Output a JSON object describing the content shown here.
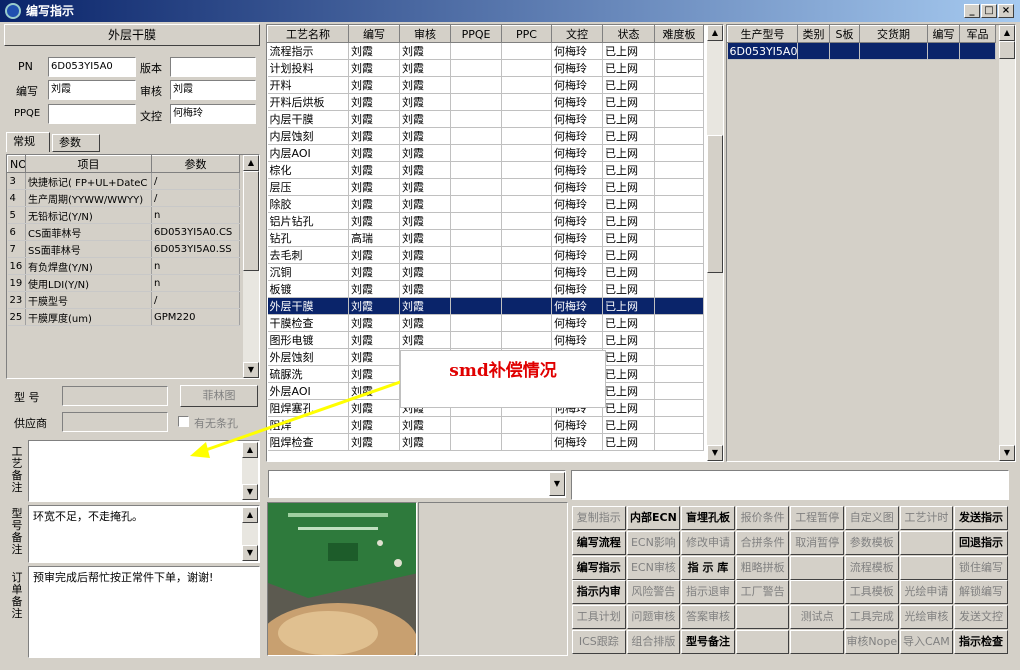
{
  "window": {
    "title": "编写指示"
  },
  "left": {
    "header": "外层干膜",
    "pn_label": "PN",
    "pn": "6D053YI5A0",
    "version_label": "版本",
    "version": "",
    "writer_label": "编写",
    "writer": "刘霞",
    "reviewer_label": "审核",
    "reviewer": "刘霞",
    "ppqe_label": "PPQE",
    "ppqe": "",
    "dc_label": "文控",
    "dc": "何梅玲",
    "tabs": [
      "常规",
      "参数"
    ],
    "param_headers": [
      "NO",
      "项目",
      "参数"
    ],
    "params": [
      {
        "no": "3",
        "item": "快捷标记( FP+UL+DateC",
        "val": "/"
      },
      {
        "no": "4",
        "item": "生产周期(YYWW/WWYY)",
        "val": "/"
      },
      {
        "no": "5",
        "item": "无铅标记(Y/N)",
        "val": "n"
      },
      {
        "no": "6",
        "item": "CS面菲林号",
        "val": "6D053YI5A0.CS"
      },
      {
        "no": "7",
        "item": "SS面菲林号",
        "val": "6D053YI5A0.SS"
      },
      {
        "no": "16",
        "item": "有负焊盘(Y/N)",
        "val": "n"
      },
      {
        "no": "19",
        "item": "使用LDI(Y/N)",
        "val": "n"
      },
      {
        "no": "23",
        "item": "干膜型号",
        "val": "/"
      },
      {
        "no": "25",
        "item": "干膜厚度(um)",
        "val": "GPM220"
      }
    ],
    "model_label": "型 号",
    "model": "",
    "film_button": "菲林图",
    "supplier_label": "供应商",
    "supplier": "",
    "no_slot_label": "有无条孔",
    "process_note_label": "工艺备注",
    "process_note": "",
    "model_note_label": "型号备注",
    "model_note": "环宽不足，不走掩孔。",
    "order_note_label": "订单备注",
    "order_note": "预审完成后帮忙按正常件下单，谢谢!"
  },
  "process": {
    "headers": [
      "工艺名称",
      "编写",
      "审核",
      "PPQE",
      "PPC",
      "文控",
      "状态",
      "难度板"
    ],
    "rows": [
      [
        "流程指示",
        "刘霞",
        "刘霞",
        "",
        "",
        "何梅玲",
        "已上网",
        ""
      ],
      [
        "计划投料",
        "刘霞",
        "刘霞",
        "",
        "",
        "何梅玲",
        "已上网",
        ""
      ],
      [
        "开料",
        "刘霞",
        "刘霞",
        "",
        "",
        "何梅玲",
        "已上网",
        ""
      ],
      [
        "开料后烘板",
        "刘霞",
        "刘霞",
        "",
        "",
        "何梅玲",
        "已上网",
        ""
      ],
      [
        "内层干膜",
        "刘霞",
        "刘霞",
        "",
        "",
        "何梅玲",
        "已上网",
        ""
      ],
      [
        "内层蚀刻",
        "刘霞",
        "刘霞",
        "",
        "",
        "何梅玲",
        "已上网",
        ""
      ],
      [
        "内层AOI",
        "刘霞",
        "刘霞",
        "",
        "",
        "何梅玲",
        "已上网",
        ""
      ],
      [
        "棕化",
        "刘霞",
        "刘霞",
        "",
        "",
        "何梅玲",
        "已上网",
        ""
      ],
      [
        "层压",
        "刘霞",
        "刘霞",
        "",
        "",
        "何梅玲",
        "已上网",
        ""
      ],
      [
        "除胶",
        "刘霞",
        "刘霞",
        "",
        "",
        "何梅玲",
        "已上网",
        ""
      ],
      [
        "铝片钻孔",
        "刘霞",
        "刘霞",
        "",
        "",
        "何梅玲",
        "已上网",
        ""
      ],
      [
        "钻孔",
        "高瑞",
        "刘霞",
        "",
        "",
        "何梅玲",
        "已上网",
        ""
      ],
      [
        "去毛刺",
        "刘霞",
        "刘霞",
        "",
        "",
        "何梅玲",
        "已上网",
        ""
      ],
      [
        "沉铜",
        "刘霞",
        "刘霞",
        "",
        "",
        "何梅玲",
        "已上网",
        ""
      ],
      [
        "板镀",
        "刘霞",
        "刘霞",
        "",
        "",
        "何梅玲",
        "已上网",
        ""
      ],
      [
        "外层干膜",
        "刘霞",
        "刘霞",
        "",
        "",
        "何梅玲",
        "已上网",
        ""
      ],
      [
        "干膜检查",
        "刘霞",
        "刘霞",
        "",
        "",
        "何梅玲",
        "已上网",
        ""
      ],
      [
        "图形电镀",
        "刘霞",
        "刘霞",
        "",
        "",
        "何梅玲",
        "已上网",
        ""
      ],
      [
        "外层蚀刻",
        "刘霞",
        "刘霞",
        "",
        "",
        "何梅玲",
        "已上网",
        ""
      ],
      [
        "硫脲洗",
        "刘霞",
        "刘霞",
        "",
        "",
        "何梅玲",
        "已上网",
        ""
      ],
      [
        "外层AOI",
        "刘霞",
        "刘霞",
        "",
        "",
        "何梅玲",
        "已上网",
        ""
      ],
      [
        "阻焊塞孔",
        "刘霞",
        "刘霞",
        "",
        "",
        "何梅玲",
        "已上网",
        ""
      ],
      [
        "阻焊",
        "刘霞",
        "刘霞",
        "",
        "",
        "何梅玲",
        "已上网",
        ""
      ],
      [
        "阻焊检查",
        "刘霞",
        "刘霞",
        "",
        "",
        "何梅玲",
        "已上网",
        ""
      ]
    ],
    "selected": 15
  },
  "production": {
    "headers": [
      "生产型号",
      "类别",
      "S板",
      "交货期",
      "编写",
      "军品"
    ],
    "rows": [
      [
        "6D053YI5A0",
        "",
        "",
        "",
        "",
        ""
      ]
    ]
  },
  "annotation": {
    "text": "smd补偿情况"
  },
  "buttons": [
    [
      "复制指示",
      "内部ECN",
      "盲埋孔板",
      "报价条件",
      "工程暂停",
      "自定义图",
      "工艺计时",
      "发送指示"
    ],
    [
      "编写流程",
      "ECN影响",
      "修改申请",
      "合拼条件",
      "取消暂停",
      "参数模板",
      "",
      "回退指示"
    ],
    [
      "编写指示",
      "ECN审核",
      "指 示 库",
      "粗略拼板",
      "",
      "流程模板",
      "",
      "锁住编写"
    ],
    [
      "指示内审",
      "风险警告",
      "指示退审",
      "工厂警告",
      "",
      "工具模板",
      "光绘申请",
      "解锁编写"
    ],
    [
      "工具计划",
      "问题审核",
      "答案审核",
      "",
      "测试点",
      "工具完成",
      "光绘审核",
      "发送文控"
    ],
    [
      "ICS跟踪",
      "组合排版",
      "型号备注",
      "",
      "",
      "审核Nope",
      "导入CAM",
      "指示检查"
    ]
  ],
  "buttons_enabled": [
    [
      false,
      true,
      true,
      false,
      false,
      false,
      false,
      true
    ],
    [
      true,
      false,
      false,
      false,
      false,
      false,
      false,
      true
    ],
    [
      true,
      false,
      true,
      false,
      false,
      false,
      false,
      false
    ],
    [
      true,
      false,
      false,
      false,
      false,
      false,
      false,
      false
    ],
    [
      false,
      false,
      false,
      false,
      false,
      false,
      false,
      false
    ],
    [
      false,
      false,
      true,
      false,
      false,
      false,
      false,
      true
    ]
  ]
}
